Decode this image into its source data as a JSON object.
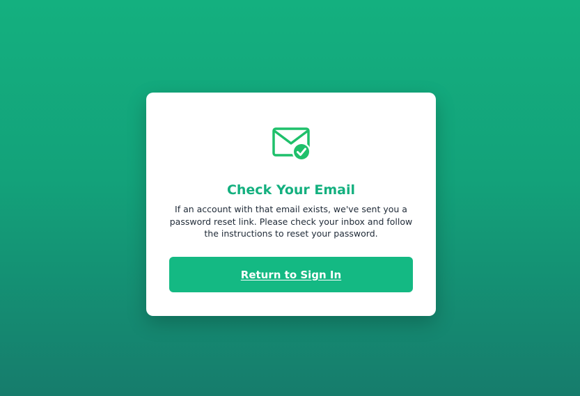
{
  "card": {
    "icon": "envelope-check-icon",
    "title": "Check Your Email",
    "message": "If an account with that email exists, we've sent you a password reset link. Please check your inbox and follow the instructions to reset your password.",
    "return_button_label": "Return to Sign In"
  },
  "colors": {
    "accent": "#14b07f",
    "button": "#14b983",
    "background_top": "#14b07f",
    "background_bottom": "#167c6c",
    "text": "#1f2a37"
  }
}
